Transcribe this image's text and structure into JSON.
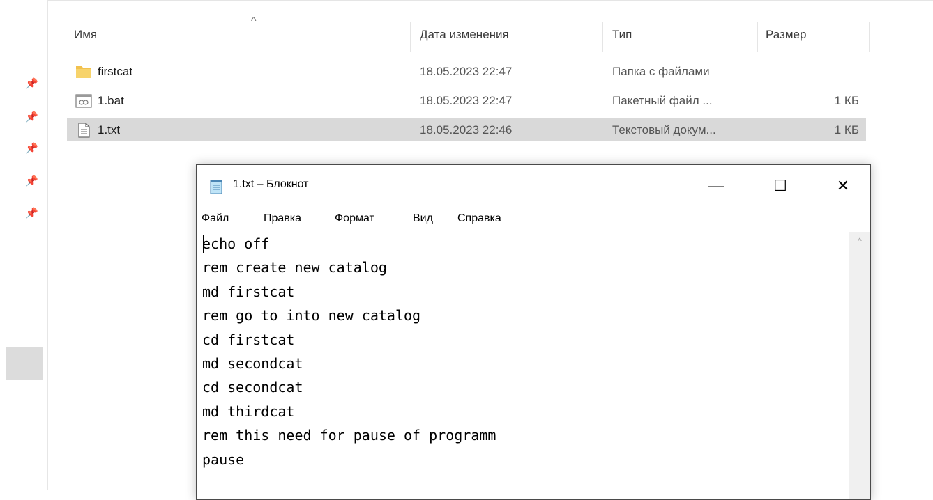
{
  "explorer": {
    "columns": {
      "name": "Имя",
      "date": "Дата изменения",
      "type": "Тип",
      "size": "Размер"
    },
    "sort_icon": "chevron-up-icon",
    "files": [
      {
        "name": "firstcat",
        "date": "18.05.2023 22:47",
        "type": "Папка с файлами",
        "size": "",
        "icon": "folder-icon",
        "selected": false
      },
      {
        "name": "1.bat",
        "date": "18.05.2023 22:47",
        "type": "Пакетный файл ...",
        "size": "1 КБ",
        "icon": "batch-file-icon",
        "selected": false
      },
      {
        "name": "1.txt",
        "date": "18.05.2023 22:46",
        "type": "Текстовый докум...",
        "size": "1 КБ",
        "icon": "text-file-icon",
        "selected": true
      }
    ],
    "pins": 5
  },
  "notepad": {
    "title": "1.txt – Блокнот",
    "buttons": {
      "minimize": "—",
      "maximize": "☐",
      "close": "✕"
    },
    "menu": [
      "Файл",
      "Правка",
      "Формат",
      "Вид",
      "Справка"
    ],
    "lines": [
      "echo off",
      "rem create new catalog",
      "md firstcat",
      "rem go to into new catalog",
      "cd firstcat",
      "md secondcat",
      "cd secondcat",
      "md thirdcat",
      "rem this need for pause of programm",
      "pause"
    ]
  },
  "colors": {
    "selected_row": "#d9d9d9",
    "folder": "#f2c14e",
    "window_border": "#4a4a4a"
  }
}
